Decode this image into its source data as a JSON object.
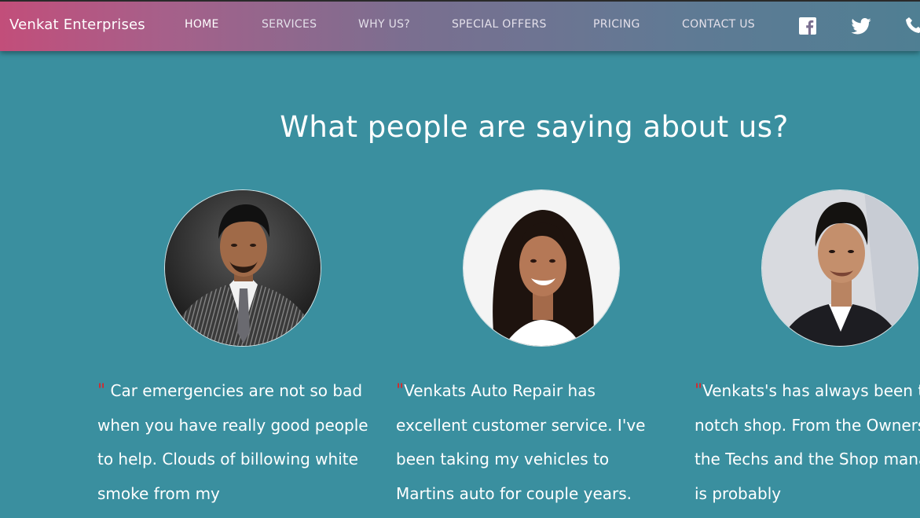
{
  "nav": {
    "brand": "Venkat Enterprises",
    "items": [
      {
        "label": "HOME",
        "active": true
      },
      {
        "label": "SERVICES"
      },
      {
        "label": "WHY US?"
      },
      {
        "label": "SPECIAL OFFERS"
      },
      {
        "label": "PRICING"
      },
      {
        "label": "CONTACT US"
      }
    ],
    "icons": [
      "facebook-icon",
      "twitter-icon",
      "phone-icon"
    ]
  },
  "testimonials": {
    "heading": "What people are saying about us?",
    "items": [
      {
        "quote_mark": "\"",
        "text": " Car emergencies are not so bad when you have really good people to help. Clouds of billowing white smoke from my"
      },
      {
        "quote_mark": "\"",
        "text": "Venkats Auto Repair has excellent customer service. I've been taking my vehicles to Martins auto for couple years."
      },
      {
        "quote_mark": "\"",
        "text": "Venkats's has always been top notch shop. From the Owners to the Techs and the Shop manager is probably"
      }
    ]
  },
  "colors": {
    "page_bg": "#3a8f9f",
    "nav_gradient_start": "#c24e7a",
    "nav_gradient_end": "#4f7f93",
    "quote_mark": "#d9262a",
    "text": "#ffffff"
  }
}
